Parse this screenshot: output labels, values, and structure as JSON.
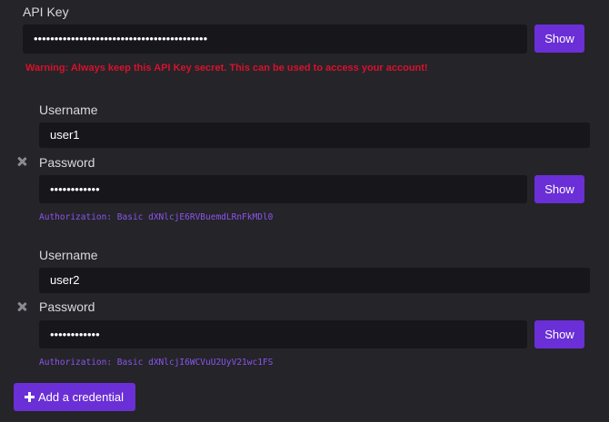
{
  "api_key": {
    "label": "API Key",
    "value": "••••••••••••••••••••••••••••••••••••••••••",
    "show_label": "Show",
    "warning": "Warning: Always keep this API Key secret. This can be used to access your account!"
  },
  "credentials": [
    {
      "username_label": "Username",
      "username": "user1",
      "password_label": "Password",
      "password": "••••••••••••",
      "show_label": "Show",
      "authorization": "Authorization: Basic dXNlcjE6RVBuemdLRnFkMDl0"
    },
    {
      "username_label": "Username",
      "username": "user2",
      "password_label": "Password",
      "password": "••••••••••••",
      "show_label": "Show",
      "authorization": "Authorization: Basic dXNlcjI6WCVuU2UyV21wc1FS"
    }
  ],
  "add_credential_label": "Add a credential",
  "colors": {
    "background": "#252429",
    "input_background": "#17161b",
    "accent": "#6a2fd6",
    "warning": "#d6122c",
    "auth_text": "#8a55ee"
  }
}
